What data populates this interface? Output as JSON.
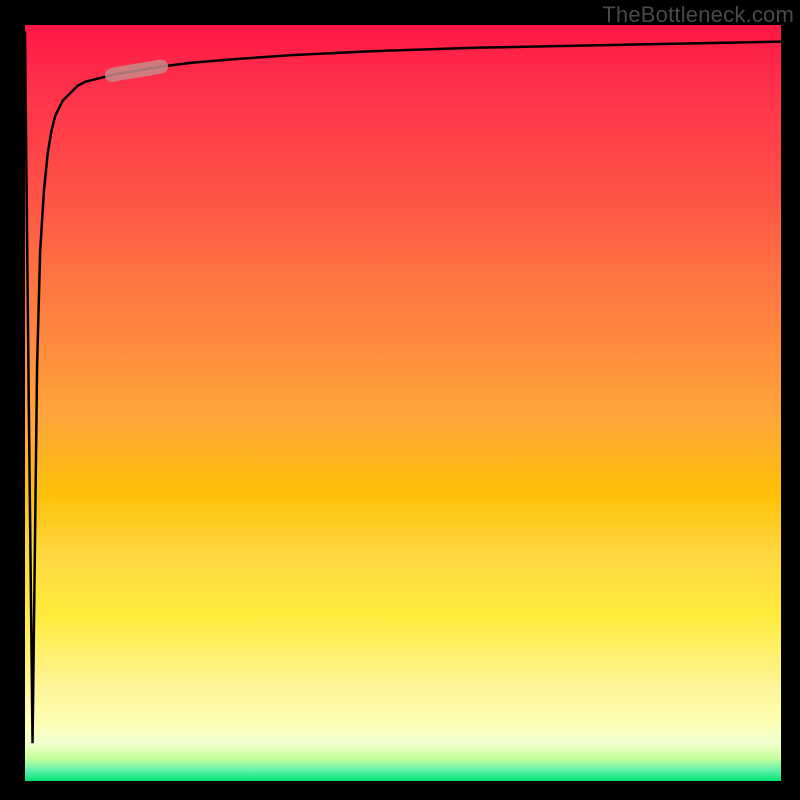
{
  "watermark": "TheBottleneck.com",
  "chart_data": {
    "type": "line",
    "title": "",
    "xlabel": "",
    "ylabel": "",
    "xlim": [
      0,
      100
    ],
    "ylim": [
      0,
      100
    ],
    "grid": false,
    "series": [
      {
        "name": "bottleneck-curve",
        "x": [
          0.0,
          0.5,
          1.0,
          1.3,
          1.6,
          2.0,
          2.5,
          3.0,
          3.5,
          4.0,
          5.0,
          6.0,
          7.0,
          8.0,
          10.0,
          12.0,
          15.0,
          18.0,
          22.0,
          28.0,
          35.0,
          45.0,
          60.0,
          75.0,
          90.0,
          100.0
        ],
        "y": [
          99.0,
          50.0,
          5.0,
          30.0,
          55.0,
          70.0,
          78.0,
          83.0,
          86.0,
          88.0,
          90.0,
          91.0,
          92.0,
          92.5,
          93.0,
          93.5,
          94.0,
          94.5,
          95.0,
          95.5,
          96.0,
          96.5,
          97.0,
          97.3,
          97.6,
          97.8
        ]
      }
    ],
    "annotations": [
      {
        "name": "marker-segment",
        "x_range": [
          11.5,
          18.0
        ],
        "y_range": [
          89.5,
          92.5
        ],
        "color": "#c58b88"
      }
    ],
    "background": {
      "type": "vertical-gradient",
      "stops": [
        {
          "offset": 0.0,
          "color": "#ff1744"
        },
        {
          "offset": 0.32,
          "color": "#ff7043"
        },
        {
          "offset": 0.62,
          "color": "#ffc107"
        },
        {
          "offset": 0.88,
          "color": "#fff59d"
        },
        {
          "offset": 1.0,
          "color": "#00e676"
        }
      ]
    }
  }
}
